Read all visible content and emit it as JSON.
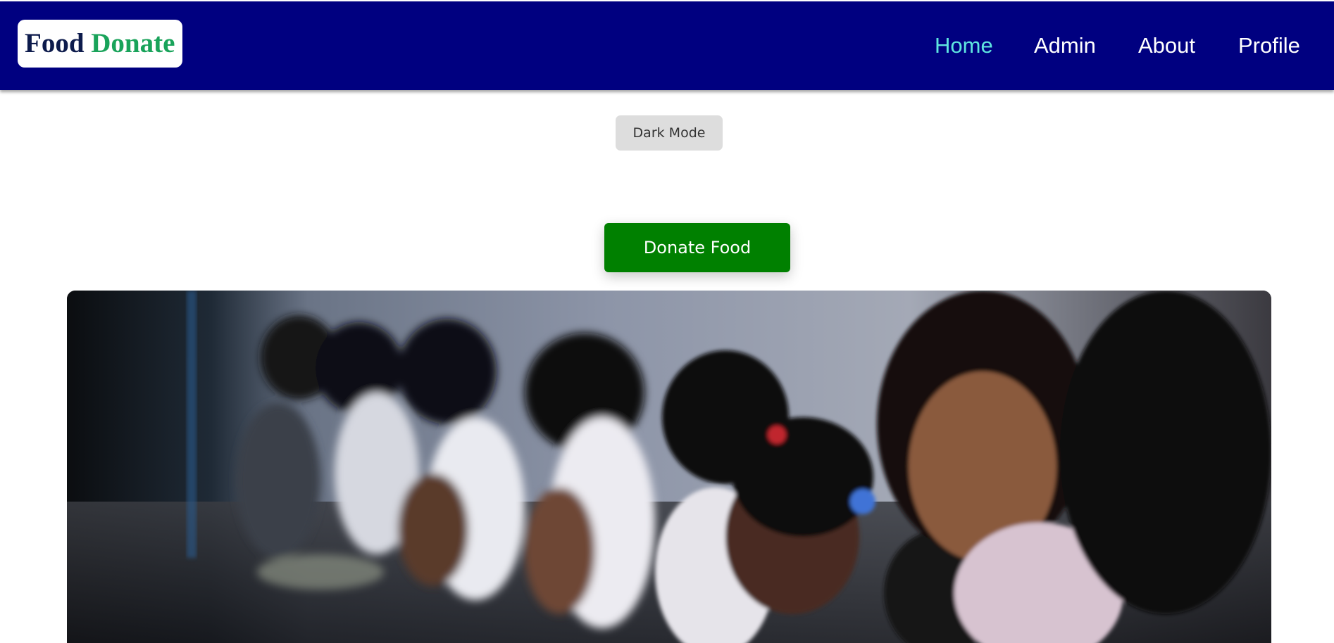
{
  "navbar": {
    "logo": {
      "word1": "Food",
      "word2": "Donate"
    },
    "links": [
      {
        "label": "Home",
        "active": true
      },
      {
        "label": "Admin",
        "active": false
      },
      {
        "label": "About",
        "active": false
      },
      {
        "label": "Profile",
        "active": false
      }
    ]
  },
  "controls": {
    "dark_mode_label": "Dark Mode",
    "donate_label": "Donate Food"
  },
  "colors": {
    "navbar_bg": "#000080",
    "active_link": "#5fe6e0",
    "donate_button": "#008000",
    "logo_word2": "#19a35a"
  }
}
